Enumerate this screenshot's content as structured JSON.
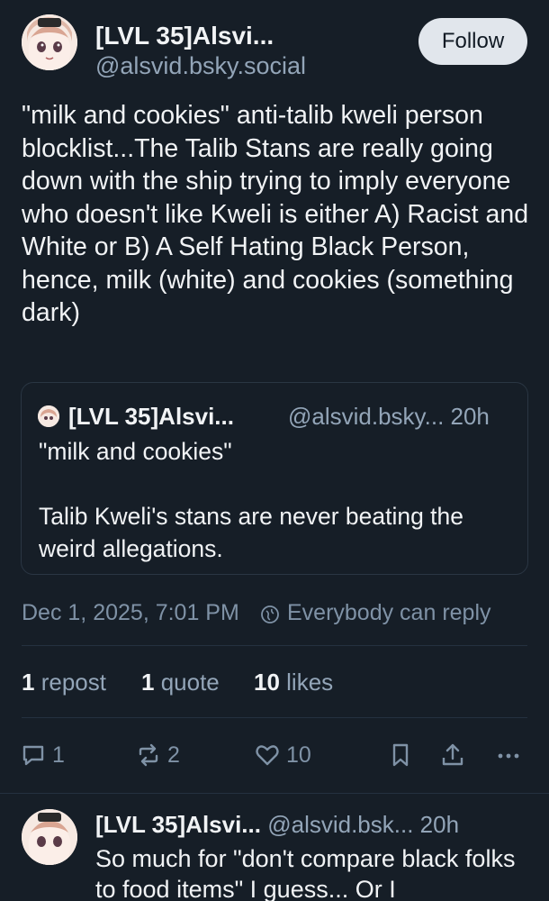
{
  "post": {
    "author_name": "[LVL 35]Alsvi...",
    "author_handle": "@alsvid.bsky.social",
    "follow_label": "Follow",
    "text": "\"milk and cookies\" anti-talib kweli person blocklist...The Talib Stans are really going down with the ship trying to imply everyone who doesn't like Kweli is either A) Racist and White or B) A Self Hating Black Person, hence, milk (white) and cookies (something dark)",
    "quote": {
      "author_name": "[LVL 35]Alsvi...",
      "author_handle": "@alsvid.bsky... 20h",
      "text": "\"milk and cookies\"\n\nTalib Kweli's stans are never beating the weird allegations."
    },
    "timestamp": "Dec 1, 2025, 7:01 PM",
    "reply_setting": "Everybody can reply",
    "stats": {
      "reposts_count": "1",
      "reposts_label": "repost",
      "quotes_count": "1",
      "quotes_label": "quote",
      "likes_count": "10",
      "likes_label": "likes"
    },
    "actions": {
      "reply_count": "1",
      "repost_count": "2",
      "like_count": "10",
      "icons": [
        "reply-icon",
        "repost-icon",
        "like-icon",
        "bookmark-icon",
        "share-icon",
        "more-icon"
      ]
    }
  },
  "reply_post": {
    "author_name": "[LVL 35]Alsvi...",
    "author_handle": "@alsvid.bsk... 20h",
    "text": "So much for \"don't compare black folks to food items\" I guess... Or I"
  },
  "colors": {
    "background": "#161e27",
    "text": "#f1f3f5",
    "muted": "#93a5b8",
    "follow_button": "#e1e6ec"
  }
}
